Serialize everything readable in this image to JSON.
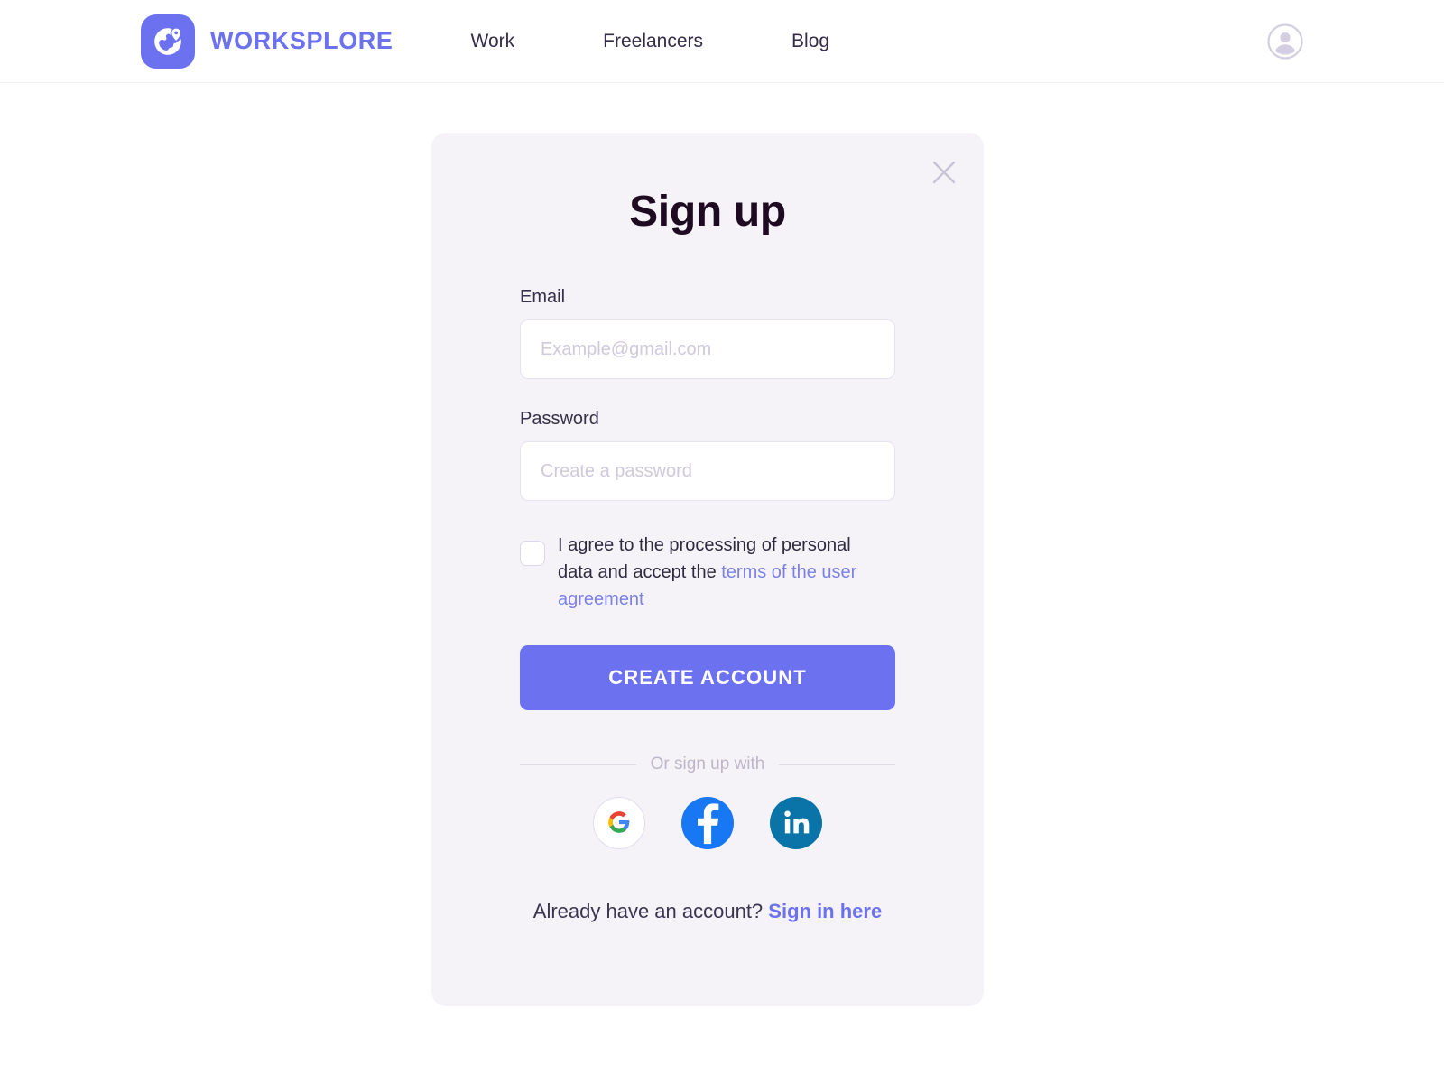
{
  "header": {
    "brand_name": "WORKSPLORE",
    "logo_icon": "globe-pin-icon",
    "nav": [
      {
        "label": "Work"
      },
      {
        "label": "Freelancers"
      },
      {
        "label": "Blog"
      }
    ],
    "avatar_icon": "account-circle-icon"
  },
  "card": {
    "title": "Sign up",
    "close_icon": "close-x-icon",
    "email": {
      "label": "Email",
      "placeholder": "Example@gmail.com",
      "value": ""
    },
    "password": {
      "label": "Password",
      "placeholder": "Create a password",
      "value": ""
    },
    "consent": {
      "checked": false,
      "text_before": "I agree to the processing of personal data and accept the ",
      "link_text": "terms of the user agreement"
    },
    "submit_label": "CREATE ACCOUNT",
    "divider_text": "Or sign up with",
    "socials": [
      {
        "name": "google",
        "icon": "google-icon"
      },
      {
        "name": "facebook",
        "icon": "facebook-icon"
      },
      {
        "name": "linkedin",
        "icon": "linkedin-icon"
      }
    ],
    "footer": {
      "prompt": "Already have an account?",
      "link_text": "Sign in here"
    }
  },
  "colors": {
    "brand_purple": "#6C72EF",
    "card_bg": "#F5F3F8",
    "page_bg": "#FFFFFF",
    "link_blue": "#7B80E8",
    "title_dark": "#1E0B22",
    "facebook_blue": "#1877F2",
    "linkedin_blue": "#0A74A8"
  }
}
